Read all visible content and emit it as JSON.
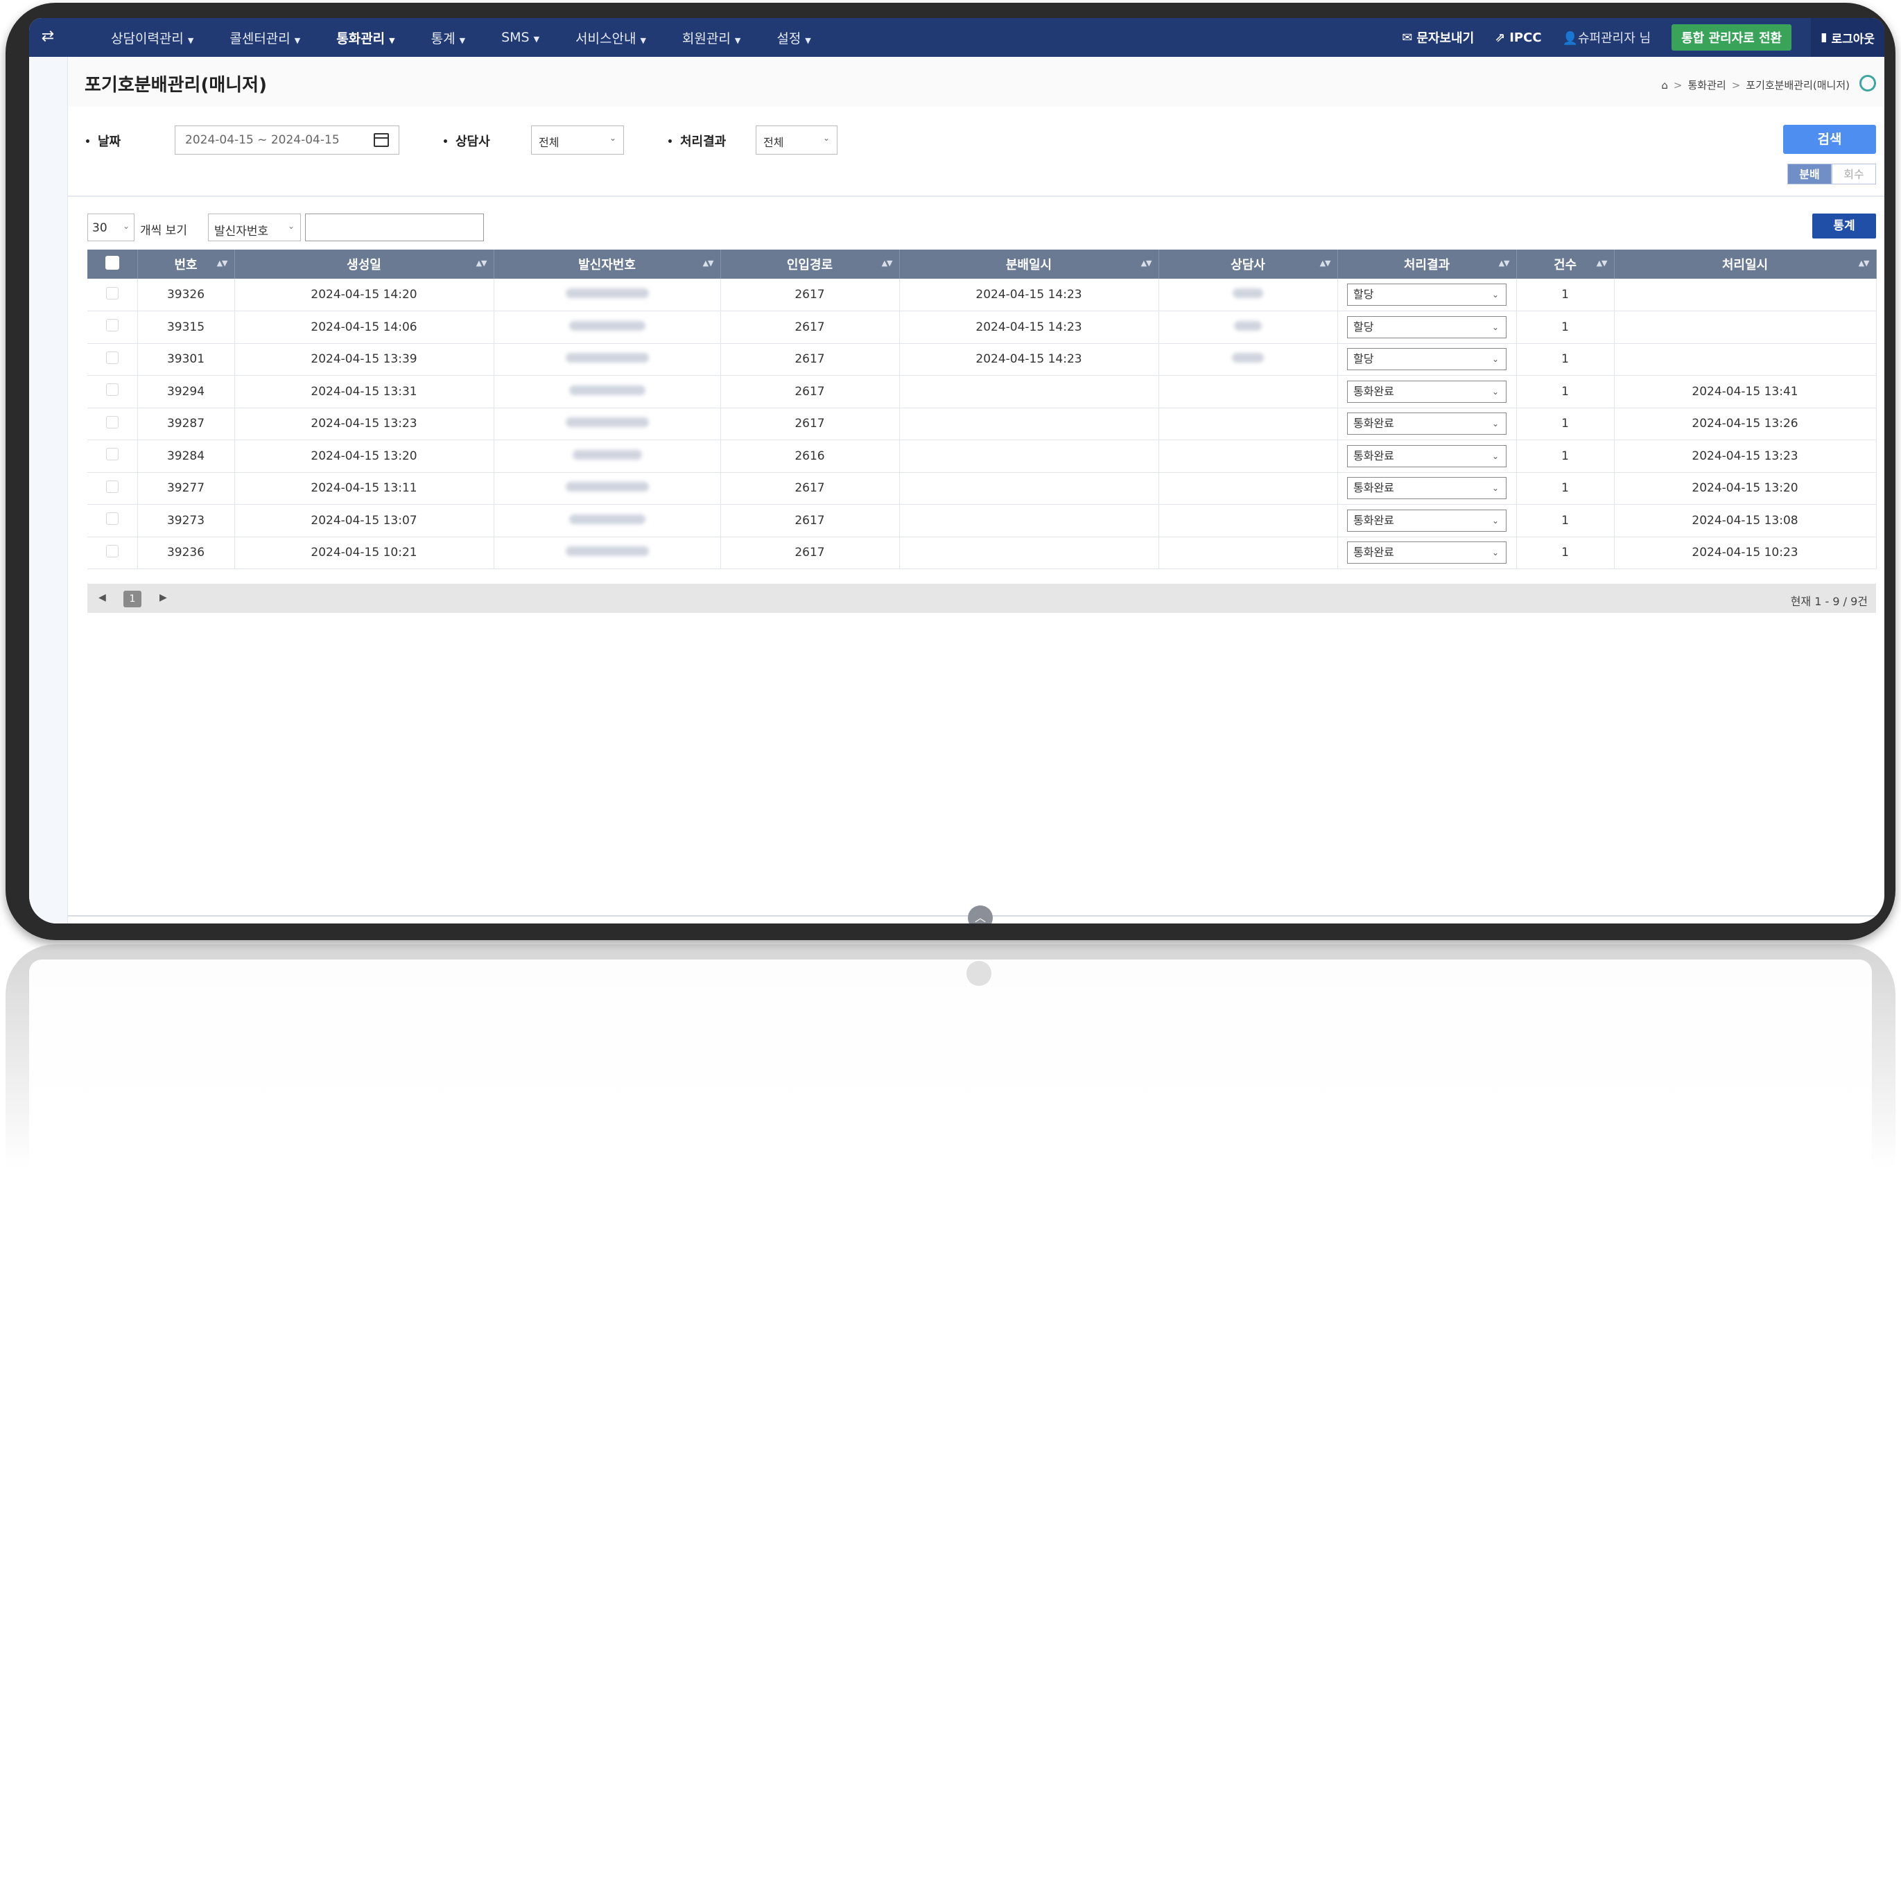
{
  "nav": {
    "items": [
      {
        "label": "상담이력관리"
      },
      {
        "label": "콜센터관리"
      },
      {
        "label": "통화관리"
      },
      {
        "label": "통계"
      },
      {
        "label": "SMS"
      },
      {
        "label": "서비스안내"
      },
      {
        "label": "회원관리"
      },
      {
        "label": "설정"
      }
    ],
    "active": "통화관리",
    "send_sms": "문자보내기",
    "ipcc": "IPCC",
    "user": "슈퍼관리자 님",
    "switch_admin": "통합 관리자로 전환",
    "logout": "로그아웃"
  },
  "page": {
    "title": "포기호분배관리(매니저)",
    "breadcrumb": [
      "통화관리",
      "포기호분배관리(매니저)"
    ]
  },
  "filters": {
    "date_label": "날짜",
    "date_value": "2024-04-15 ~ 2024-04-15",
    "agent_label": "상담사",
    "agent_value": "전체",
    "result_label": "처리결과",
    "result_value": "전체",
    "search_button": "검색",
    "toggle_on": "분배",
    "toggle_off": "회수"
  },
  "controls": {
    "per_page": "30",
    "per_page_label": "개씩 보기",
    "search_field": "발신자번호",
    "search_value": "",
    "stats_button": "통계"
  },
  "table": {
    "headers": [
      "번호",
      "생성일",
      "발신자번호",
      "인입경로",
      "분배일시",
      "상담사",
      "처리결과",
      "건수",
      "처리일시"
    ],
    "rows": [
      {
        "id": "39326",
        "created": "2024-04-15 14:20",
        "route": "2617",
        "dist": "2024-04-15 14:23",
        "result": "할당",
        "count": "1",
        "processed": ""
      },
      {
        "id": "39315",
        "created": "2024-04-15 14:06",
        "route": "2617",
        "dist": "2024-04-15 14:23",
        "result": "할당",
        "count": "1",
        "processed": ""
      },
      {
        "id": "39301",
        "created": "2024-04-15 13:39",
        "route": "2617",
        "dist": "2024-04-15 14:23",
        "result": "할당",
        "count": "1",
        "processed": ""
      },
      {
        "id": "39294",
        "created": "2024-04-15 13:31",
        "route": "2617",
        "dist": "",
        "result": "통화완료",
        "count": "1",
        "processed": "2024-04-15 13:41"
      },
      {
        "id": "39287",
        "created": "2024-04-15 13:23",
        "route": "2617",
        "dist": "",
        "result": "통화완료",
        "count": "1",
        "processed": "2024-04-15 13:26"
      },
      {
        "id": "39284",
        "created": "2024-04-15 13:20",
        "route": "2616",
        "dist": "",
        "result": "통화완료",
        "count": "1",
        "processed": "2024-04-15 13:23"
      },
      {
        "id": "39277",
        "created": "2024-04-15 13:11",
        "route": "2617",
        "dist": "",
        "result": "통화완료",
        "count": "1",
        "processed": "2024-04-15 13:20"
      },
      {
        "id": "39273",
        "created": "2024-04-15 13:07",
        "route": "2617",
        "dist": "",
        "result": "통화완료",
        "count": "1",
        "processed": "2024-04-15 13:08"
      },
      {
        "id": "39236",
        "created": "2024-04-15 10:21",
        "route": "2617",
        "dist": "",
        "result": "통화완료",
        "count": "1",
        "processed": "2024-04-15 10:23"
      }
    ]
  },
  "pager": {
    "current": "1",
    "summary": "현재 1 - 9 / 9건"
  },
  "colors": {
    "nav_bg": "#213a74",
    "primary_button": "#4e8ef0",
    "switch_button": "#3aa35a",
    "table_header": "#6a7a93"
  }
}
